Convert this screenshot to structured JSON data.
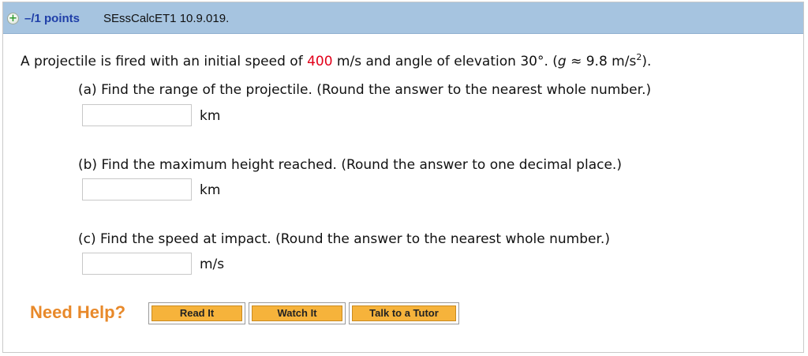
{
  "header": {
    "toggle_icon": "plus-icon",
    "toggle_symbol": "+",
    "points": "–/1 points",
    "problem_id": "SEssCalcET1 10.9.019."
  },
  "question": {
    "stem_before_speed": "A projectile is fired with an initial speed of ",
    "speed_value": "400",
    "stem_after_speed": " m/s and angle of elevation 30°. (",
    "g_symbol": "g",
    "approx_value": " ≈ 9.8 m/s",
    "exponent": "2",
    "stem_close": ").",
    "speed_color": "#e2001a"
  },
  "parts": [
    {
      "prompt": "(a) Find the range of the projectile. (Round the answer to the nearest whole number.)",
      "value": "",
      "unit": "km"
    },
    {
      "prompt": "(b) Find the maximum height reached. (Round the answer to one decimal place.)",
      "value": "",
      "unit": "km"
    },
    {
      "prompt": "(c) Find the speed at impact. (Round the answer to the nearest whole number.)",
      "value": "",
      "unit": "m/s"
    }
  ],
  "help": {
    "label": "Need Help?",
    "buttons": [
      "Read It",
      "Watch It",
      "Talk to a Tutor"
    ],
    "label_color": "#e8892a",
    "button_color": "#f6b33b"
  }
}
